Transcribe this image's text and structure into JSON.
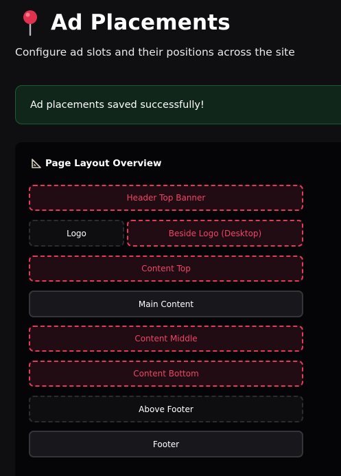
{
  "header": {
    "title": "Ad Placements",
    "subtitle": "Configure ad slots and their positions across the site",
    "icon": "pushpin-icon"
  },
  "alert": {
    "message": "Ad placements saved successfully!",
    "status": "success"
  },
  "layout_overview": {
    "title": "Page Layout Overview",
    "icon": "triangular-ruler-icon",
    "slots": {
      "header_top_banner": "Header Top Banner",
      "logo": "Logo",
      "beside_logo": "Beside Logo (Desktop)",
      "content_top": "Content Top",
      "main_content": "Main Content",
      "content_middle": "Content Middle",
      "content_bottom": "Content Bottom",
      "above_footer": "Above Footer",
      "footer": "Footer"
    }
  },
  "colors": {
    "background": "#0f0f12",
    "ad_slot_accent": "#e33a5c",
    "ad_slot_fill": "#220c14",
    "success_fill": "#10261b",
    "success_border": "#1e5a3a"
  }
}
